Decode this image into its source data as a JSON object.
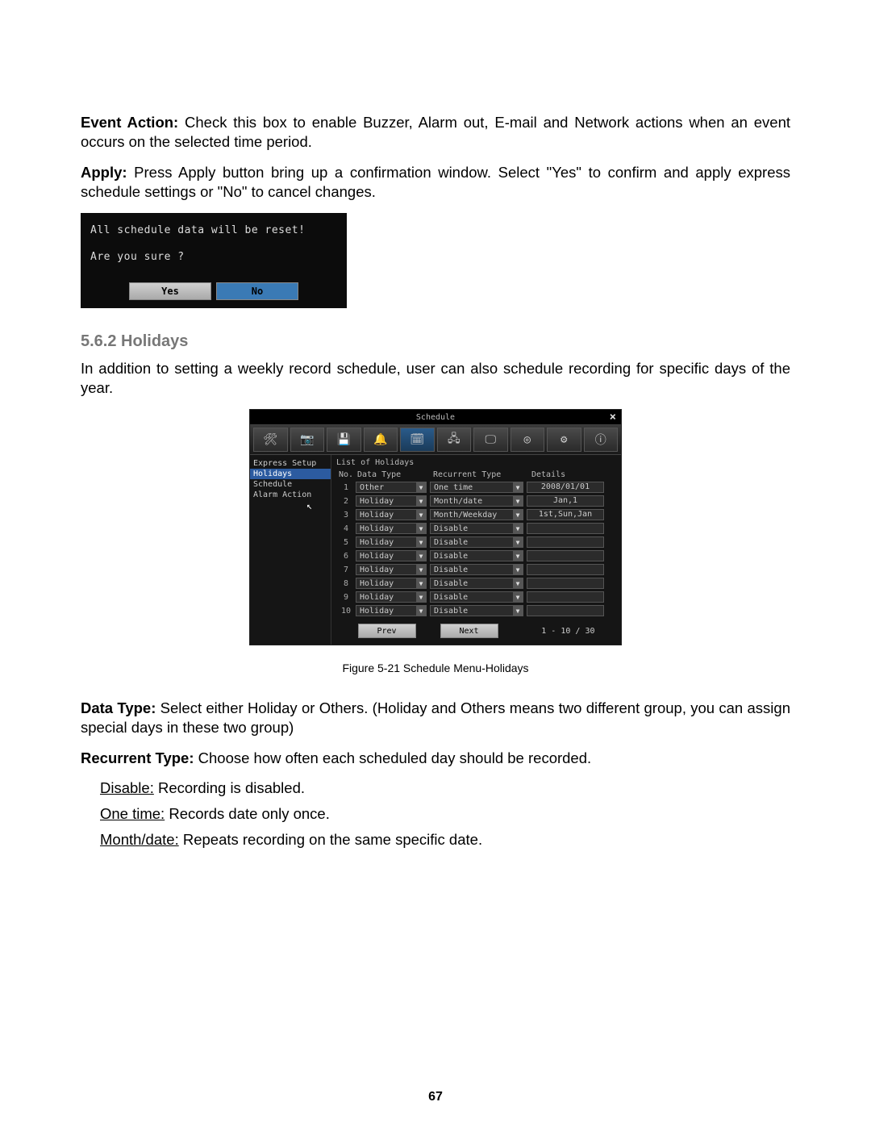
{
  "paragraphs": {
    "event_action_label": "Event Action:",
    "event_action_text": " Check this box to enable Buzzer, Alarm out, E-mail and Network actions when an event occurs on the selected time period.",
    "apply_label": "Apply:",
    "apply_text": " Press Apply button bring up a confirmation window. Select \"Yes\" to confirm and apply express schedule settings or \"No\" to cancel changes.",
    "holidays_intro": "In addition to setting a weekly record schedule, user can also schedule recording for specific days of the year.",
    "data_type_label": "Data Type:",
    "data_type_text": " Select either Holiday or Others. (Holiday and Others means two different group, you can assign special days in these two group)",
    "recurrent_type_label": "Recurrent Type:",
    "recurrent_type_text": " Choose how often each scheduled day should be recorded."
  },
  "confirm_dialog": {
    "line1": "All schedule data will be reset!",
    "line2": "Are you sure ?",
    "yes": "Yes",
    "no": "No"
  },
  "section_heading": "5.6.2  Holidays",
  "schedule_window": {
    "title": "Schedule",
    "sidebar": {
      "items": [
        "Express Setup",
        "Holidays",
        "Schedule",
        "Alarm Action"
      ],
      "selected_index": 1
    },
    "list_title": "List of Holidays",
    "headers": {
      "no": "No.",
      "data_type": "Data Type",
      "recurrent_type": "Recurrent Type",
      "details": "Details"
    },
    "rows": [
      {
        "no": "1",
        "data_type": "Other",
        "recurrent_type": "One time",
        "details": "2008/01/01"
      },
      {
        "no": "2",
        "data_type": "Holiday",
        "recurrent_type": "Month/date",
        "details": "Jan,1"
      },
      {
        "no": "3",
        "data_type": "Holiday",
        "recurrent_type": "Month/Weekday",
        "details": "1st,Sun,Jan"
      },
      {
        "no": "4",
        "data_type": "Holiday",
        "recurrent_type": "Disable",
        "details": ""
      },
      {
        "no": "5",
        "data_type": "Holiday",
        "recurrent_type": "Disable",
        "details": ""
      },
      {
        "no": "6",
        "data_type": "Holiday",
        "recurrent_type": "Disable",
        "details": ""
      },
      {
        "no": "7",
        "data_type": "Holiday",
        "recurrent_type": "Disable",
        "details": ""
      },
      {
        "no": "8",
        "data_type": "Holiday",
        "recurrent_type": "Disable",
        "details": ""
      },
      {
        "no": "9",
        "data_type": "Holiday",
        "recurrent_type": "Disable",
        "details": ""
      },
      {
        "no": "10",
        "data_type": "Holiday",
        "recurrent_type": "Disable",
        "details": ""
      }
    ],
    "prev": "Prev",
    "next": "Next",
    "page_indicator": "1 - 10 / 30"
  },
  "figure_caption": "Figure 5-21 Schedule Menu-Holidays",
  "definitions": [
    {
      "term": "Disable:",
      "text": " Recording is disabled."
    },
    {
      "term": "One time:",
      "text": " Records date only once."
    },
    {
      "term": "Month/date:",
      "text": " Repeats recording on the same specific date."
    }
  ],
  "page_number": "67"
}
